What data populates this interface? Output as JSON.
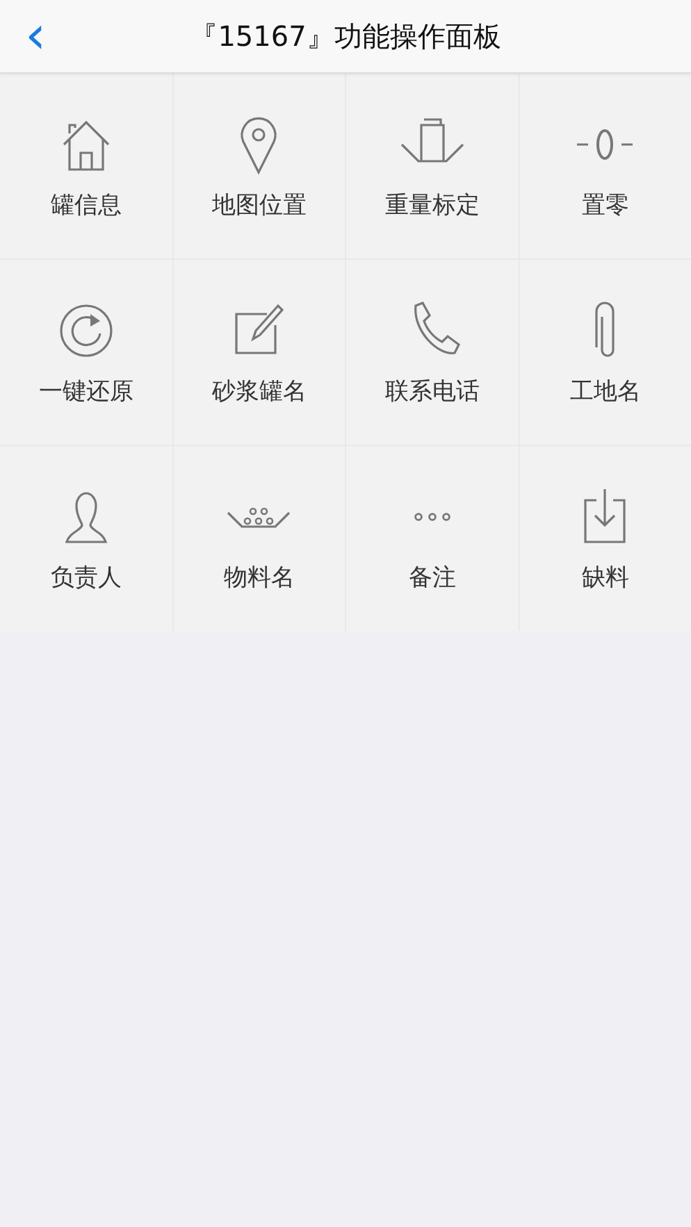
{
  "header": {
    "back": "‹",
    "title": "『15167』功能操作面板"
  },
  "tiles": [
    {
      "kind": "house",
      "label": "罐信息"
    },
    {
      "kind": "pin",
      "label": "地图位置"
    },
    {
      "kind": "scale",
      "label": "重量标定"
    },
    {
      "kind": "zero",
      "label": "置零"
    },
    {
      "kind": "reset",
      "label": "一键还原"
    },
    {
      "kind": "edit",
      "label": "砂浆罐名"
    },
    {
      "kind": "phone",
      "label": "联系电话"
    },
    {
      "kind": "clip",
      "label": "工地名"
    },
    {
      "kind": "person",
      "label": "负责人"
    },
    {
      "kind": "bowl",
      "label": "物料名"
    },
    {
      "kind": "dots",
      "label": "备注"
    },
    {
      "kind": "download",
      "label": "缺料"
    }
  ]
}
